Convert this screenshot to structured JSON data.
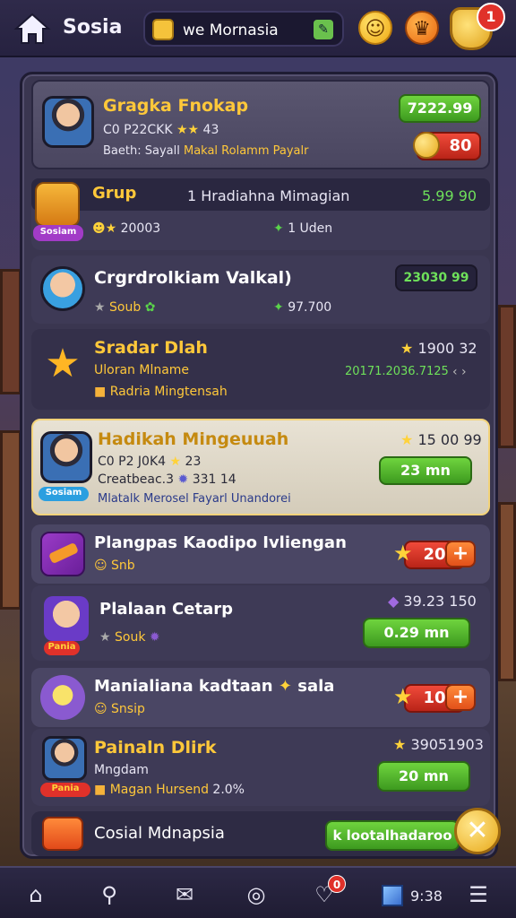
{
  "header": {
    "title": "Sosia",
    "search_text": "we Mornasia",
    "notification_count": "1"
  },
  "rows": [
    {
      "title": "Gragka Fnokap",
      "line1": "C0 P22CKK",
      "line1_value": "43",
      "line2_a": "Baeth: Sayall",
      "line2_b": "Makal Rolamm Payalr",
      "amount": "7222.99",
      "coin_amount": "80"
    },
    {
      "title": "Grup",
      "header_text": "1 Hradiahna Mimagian",
      "amount": "5.99 90",
      "badge": "Sosiam",
      "stat1": "20003",
      "stat2": "1 Uden"
    },
    {
      "title": "Crgrdrolkiam Valkal)",
      "amount": "23030 99",
      "sub1": "Soub",
      "sub2": "97.700"
    },
    {
      "title": "Sradar Dlah",
      "line1": "Uloran Mlname",
      "line2": "Radria Mingtensah",
      "value": "1900 32",
      "sub_value": "20171.2036.7125"
    },
    {
      "title": "Hadikah Mingeuuah",
      "line1": "C0 P2 J0K4",
      "line1_value": "23",
      "line2": "Creatbeac.3",
      "line2_value": "331 14",
      "line3": "Mlatalk Merosel Fayarl Unandorei",
      "badge": "Sosiam",
      "value": "15 00 99",
      "button": "23 mn"
    },
    {
      "title": "Plangpas Kaodipo Ivliengan",
      "sub": "Snb",
      "count": "20"
    },
    {
      "title": "Plalaan Cetarp",
      "sub": "Souk",
      "value": "39.23 150",
      "button": "0.29 mn",
      "badge": "Pania"
    },
    {
      "title": "Manialiana kadtaan",
      "title_tail": "sala",
      "sub": "Snsip",
      "count": "10"
    },
    {
      "title": "Painaln Dlirk",
      "line1": "Mngdam",
      "line2": "Magan Hursend",
      "line2_value": "2.0%",
      "value": "39051903",
      "button": "20 mn",
      "badge": "Pania"
    }
  ],
  "footer": {
    "label": "Cosial Mdnapsia",
    "button": "k lootalhadaroo"
  },
  "nav": {
    "heart_badge": "0",
    "cube_count": "9:38"
  }
}
